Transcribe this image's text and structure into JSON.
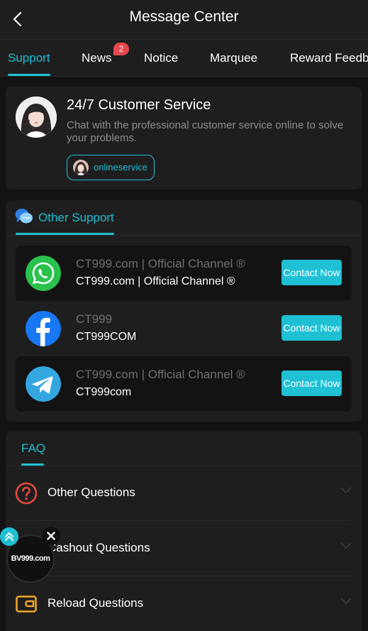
{
  "header": {
    "title": "Message Center",
    "back_icon": "chevron-left-icon"
  },
  "tabs": [
    {
      "label": "Support",
      "active": true
    },
    {
      "label": "News",
      "badge": "2"
    },
    {
      "label": "Notice"
    },
    {
      "label": "Marquee"
    },
    {
      "label": "Reward Feedb"
    }
  ],
  "customer_service": {
    "title": "24/7 Customer Service",
    "description": "Chat with the professional customer service online to solve your problems.",
    "online_label": "onlineservice",
    "avatar_icon": "agent-avatar-icon"
  },
  "other_support": {
    "title": "Other Support",
    "icon": "chat-bubble-icon",
    "channels": [
      {
        "icon": "whatsapp-icon",
        "name": "CT999.com | Official Channel ®",
        "handle": "CT999.com | Official Channel ®",
        "button": "Contact Now"
      },
      {
        "icon": "facebook-icon",
        "name": "CT999",
        "handle": "CT999COM",
        "button": "Contact Now"
      },
      {
        "icon": "telegram-icon",
        "name": "CT999.com | Official Channel ®",
        "handle": "CT999com",
        "button": "Contact Now"
      }
    ]
  },
  "faq": {
    "title": "FAQ",
    "items": [
      {
        "icon": "question-circle-icon",
        "label": "Other Questions"
      },
      {
        "icon": "cashout-icon",
        "label": "Cashout Questions"
      },
      {
        "icon": "wallet-icon",
        "label": "Reload Questions"
      }
    ]
  },
  "floating": {
    "logo_text": "BV999.com"
  },
  "colors": {
    "accent": "#1fc0d4",
    "background": "#131313",
    "card": "#1e1e1e",
    "badge": "#e8484e"
  }
}
